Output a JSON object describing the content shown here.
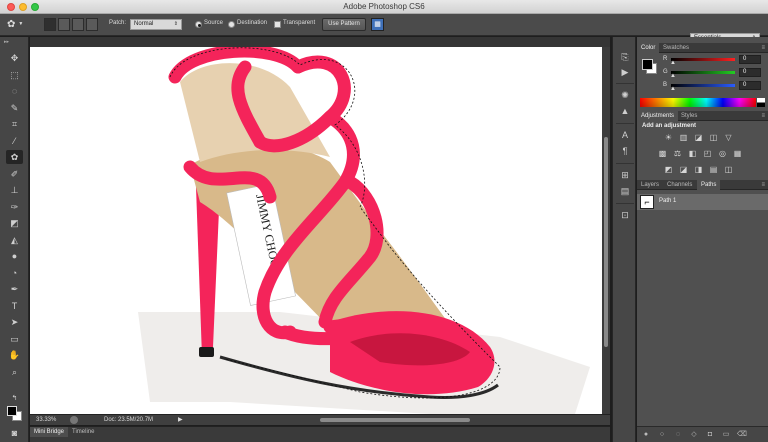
{
  "window": {
    "title": "Adobe Photoshop CS6"
  },
  "options_bar": {
    "patch_label": "Patch:",
    "patch_mode": "Normal",
    "source_label": "Source",
    "destination_label": "Destination",
    "transparent_label": "Transparent",
    "use_pattern_label": "Use Pattern",
    "workspace": "Essentials"
  },
  "toolbar": {
    "tools": [
      {
        "name": "move-tool",
        "glyph": "✥"
      },
      {
        "name": "marquee-tool",
        "glyph": "⬚"
      },
      {
        "name": "lasso-tool",
        "glyph": "◌"
      },
      {
        "name": "quick-selection-tool",
        "glyph": "✎"
      },
      {
        "name": "crop-tool",
        "glyph": "⌗"
      },
      {
        "name": "eyedropper-tool",
        "glyph": "⁄"
      },
      {
        "name": "patch-tool",
        "glyph": "✿"
      },
      {
        "name": "brush-tool",
        "glyph": "✐"
      },
      {
        "name": "clone-stamp-tool",
        "glyph": "⊥"
      },
      {
        "name": "history-brush-tool",
        "glyph": "✑"
      },
      {
        "name": "eraser-tool",
        "glyph": "◩"
      },
      {
        "name": "paint-bucket-tool",
        "glyph": "◭"
      },
      {
        "name": "blur-tool",
        "glyph": "●"
      },
      {
        "name": "dodge-tool",
        "glyph": "◔"
      },
      {
        "name": "pen-tool",
        "glyph": "✒"
      },
      {
        "name": "type-tool",
        "glyph": "T"
      },
      {
        "name": "path-selection-tool",
        "glyph": "➤"
      },
      {
        "name": "rectangle-tool",
        "glyph": "▭"
      },
      {
        "name": "hand-tool",
        "glyph": "✋"
      },
      {
        "name": "zoom-tool",
        "glyph": "⌕"
      }
    ]
  },
  "status_bar": {
    "zoom": "33.33%",
    "doc_info": "Doc: 23.5M/20.7M"
  },
  "bottom_panel": {
    "tabs": [
      "Mini Bridge",
      "Timeline"
    ]
  },
  "color_panel": {
    "tabs": [
      "Color",
      "Swatches"
    ],
    "channels": [
      {
        "label": "R",
        "value": "0",
        "color": "#ff2020"
      },
      {
        "label": "G",
        "value": "0",
        "color": "#22cc22"
      },
      {
        "label": "B",
        "value": "0",
        "color": "#2a5cff"
      }
    ]
  },
  "adjustments_panel": {
    "tabs": [
      "Adjustments",
      "Styles"
    ],
    "title": "Add an adjustment"
  },
  "layers_panel": {
    "tabs": [
      "Layers",
      "Channels",
      "Paths"
    ],
    "paths": [
      {
        "name": "Path 1"
      }
    ]
  },
  "colors": {
    "shoe_pink": "#f4245a",
    "shoe_pink_shadow": "#c8163f",
    "insole": "#d8b98a",
    "strap_inner": "#e7d1b0",
    "shadow_floor": "#efedeb"
  }
}
